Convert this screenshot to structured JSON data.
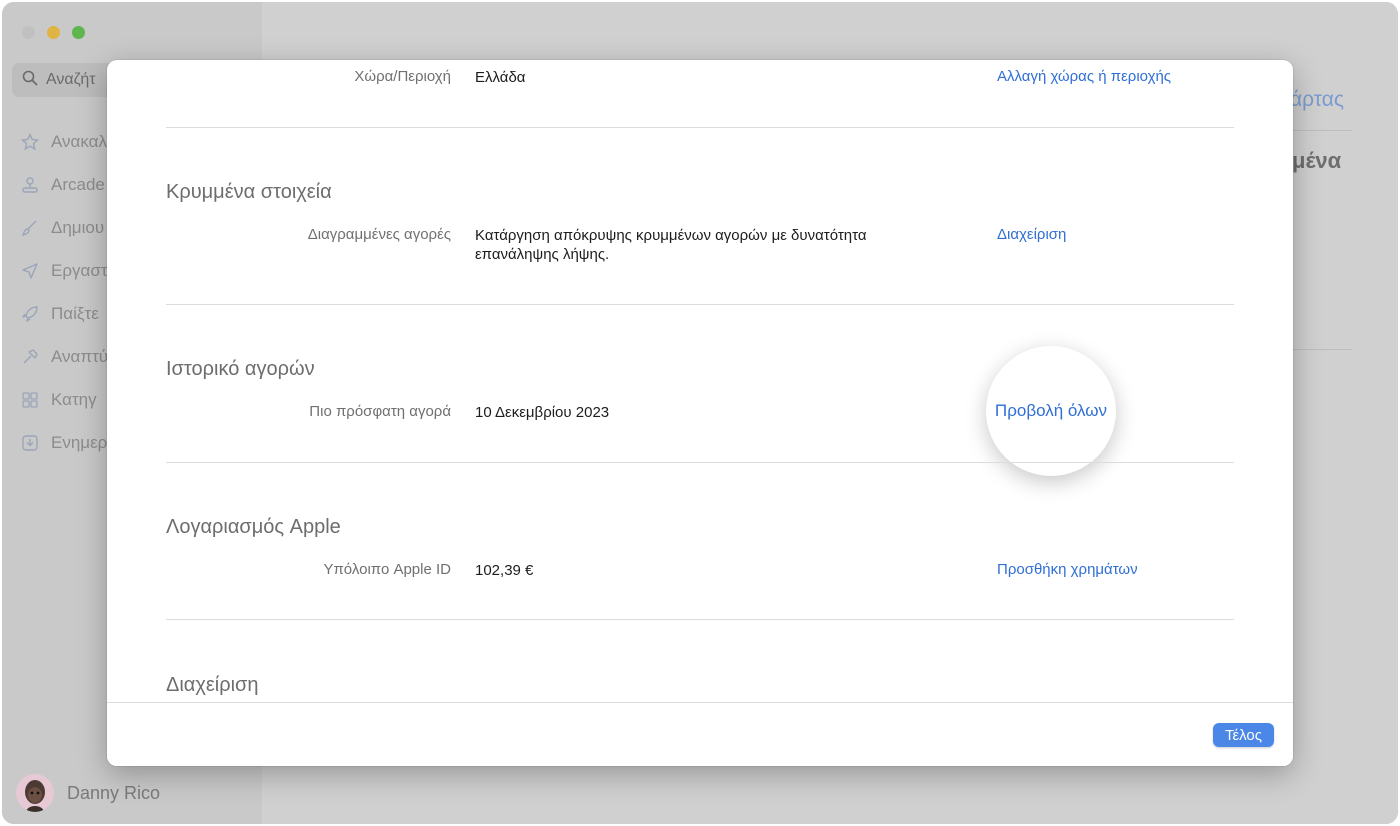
{
  "app": {
    "search_placeholder": "Αναζήτ",
    "sidebar_items": [
      {
        "label": "Ανακαλ",
        "icon": "star-icon"
      },
      {
        "label": "Arcade",
        "icon": "joystick-icon"
      },
      {
        "label": "Δημιου",
        "icon": "brush-icon"
      },
      {
        "label": "Εργαστ",
        "icon": "paper-plane-icon"
      },
      {
        "label": "Παίξτε",
        "icon": "rocket-icon"
      },
      {
        "label": "Αναπτύ",
        "icon": "hammer-icon"
      },
      {
        "label": "Κατηγ",
        "icon": "grid-icon"
      },
      {
        "label": "Ενημερ",
        "icon": "download-tray-icon"
      }
    ],
    "user_name": "Danny Rico",
    "background_link": "άρτας",
    "background_heading": "μένα"
  },
  "sheet": {
    "country": {
      "label": "Χώρα/Περιοχή",
      "value": "Ελλάδα",
      "link": "Αλλαγή χώρας ή περιοχής"
    },
    "hidden": {
      "title": "Κρυμμένα στοιχεία",
      "label": "Διαγραμμένες αγορές",
      "value_line1": "Κατάργηση απόκρυψης κρυμμένων αγορών με δυνατότητα",
      "value_line2": "επανάληψης λήψης.",
      "link": "Διαχείριση"
    },
    "history": {
      "title": "Ιστορικό αγορών",
      "label": "Πιο πρόσφατη αγορά",
      "value": "10 Δεκεμβρίου 2023",
      "link": "Προβολή όλων"
    },
    "account": {
      "title": "Λογαριασμός Apple",
      "label": "Υπόλοιπο Apple ID",
      "value": "102,39 €",
      "link": "Προσθήκη χρημάτων"
    },
    "manage": {
      "title": "Διαχείριση"
    },
    "done_label": "Τέλος"
  },
  "colors": {
    "accent": "#2f6fd6",
    "button": "#4a87e6"
  }
}
